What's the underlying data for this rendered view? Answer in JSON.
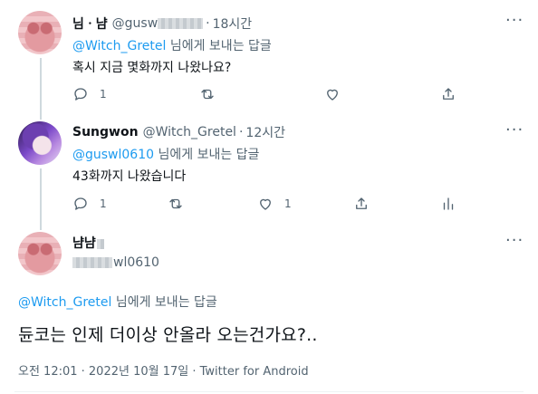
{
  "tweets": [
    {
      "name": "님ㆍ냠",
      "handle": "@gusw",
      "time": "18시간",
      "reply_handle": "@Witch_Gretel",
      "reply_suffix": " 님에게 보내는 답글",
      "text": "혹시 지금 몇화까지 나왔나요?",
      "reply_count": "1",
      "like_count": ""
    },
    {
      "name": "Sungwon",
      "handle": "@Witch_Gretel",
      "time": "12시간",
      "reply_handle": "@guswl0610",
      "reply_suffix": " 님에게 보내는 답글",
      "text": "43화까지 나왔습니다",
      "reply_count": "1",
      "like_count": "1"
    }
  ],
  "focus": {
    "name": "냠냠",
    "handle": "wl0610",
    "reply_handle": "@Witch_Gretel",
    "reply_suffix": " 님에게 보내는 답글",
    "text": "듄코는 인제 더이상 안올라 오는건가요?..",
    "meta": "오전 12:01 · 2022년 10월 17일 · Twitter for Android"
  },
  "separator": "·",
  "icons": [
    "reply-icon",
    "retweet-icon",
    "like-icon",
    "share-icon",
    "analytics-icon",
    "more-icon"
  ],
  "colors": {
    "accent": "#1d9bf0",
    "muted": "#536471",
    "text": "#0f1419",
    "line": "#cfd9de"
  }
}
